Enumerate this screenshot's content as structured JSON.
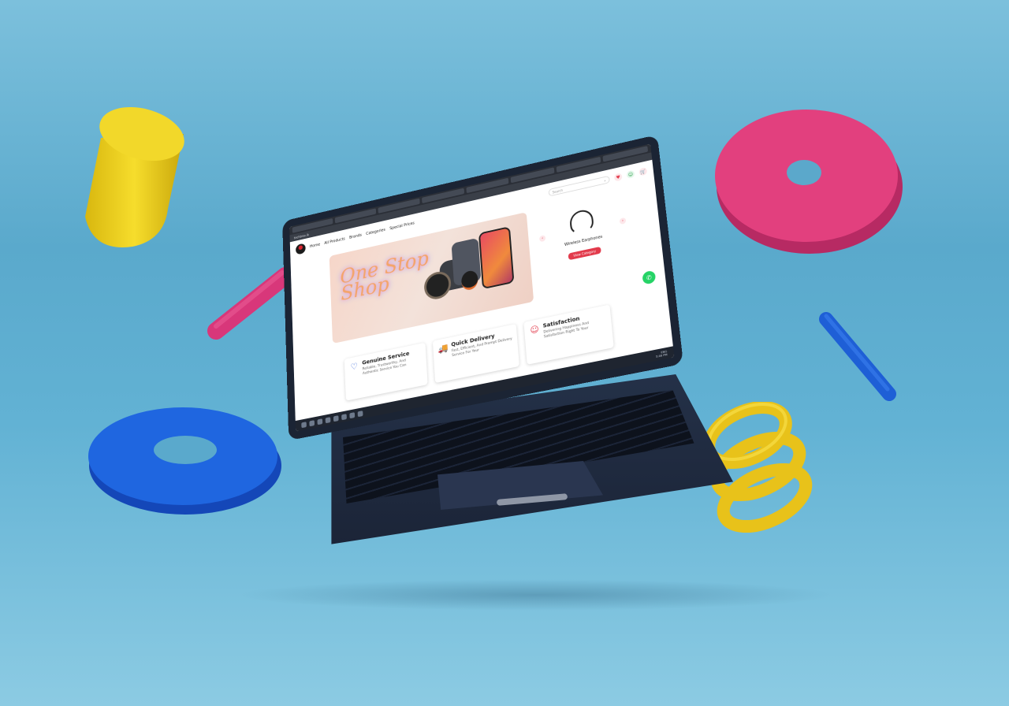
{
  "colors": {
    "background": "#62b2d4",
    "brand_red": "#e23a4b",
    "whatsapp_green": "#25d366"
  },
  "browser": {
    "url": "techtree.lk"
  },
  "site": {
    "nav": [
      "Home",
      "All Products",
      "Brands",
      "Categories",
      "Special Prices"
    ],
    "search_placeholder": "Search",
    "icons": {
      "wishlist": "heart-icon",
      "account": "user-icon",
      "cart": "cart-icon"
    }
  },
  "banner": {
    "neon_line1": "One Stop",
    "neon_line2": "Shop"
  },
  "side_product": {
    "title": "Wireless Earphones",
    "button": "View Category"
  },
  "features": [
    {
      "title": "Genuine Service",
      "desc": "Reliable, Trustworthy, And Authentic Service You Can",
      "icon": "heart-icon"
    },
    {
      "title": "Quick Delivery",
      "desc": "Fast, Efficient, And Prompt Delivery Service For Your",
      "icon": "truck-icon"
    },
    {
      "title": "Satisfaction",
      "desc": "Delivering Happiness And Satisfaction Right To Your",
      "icon": "smile-icon"
    }
  ],
  "taskbar": {
    "time": "5:46 PM",
    "lang": "ENG"
  }
}
